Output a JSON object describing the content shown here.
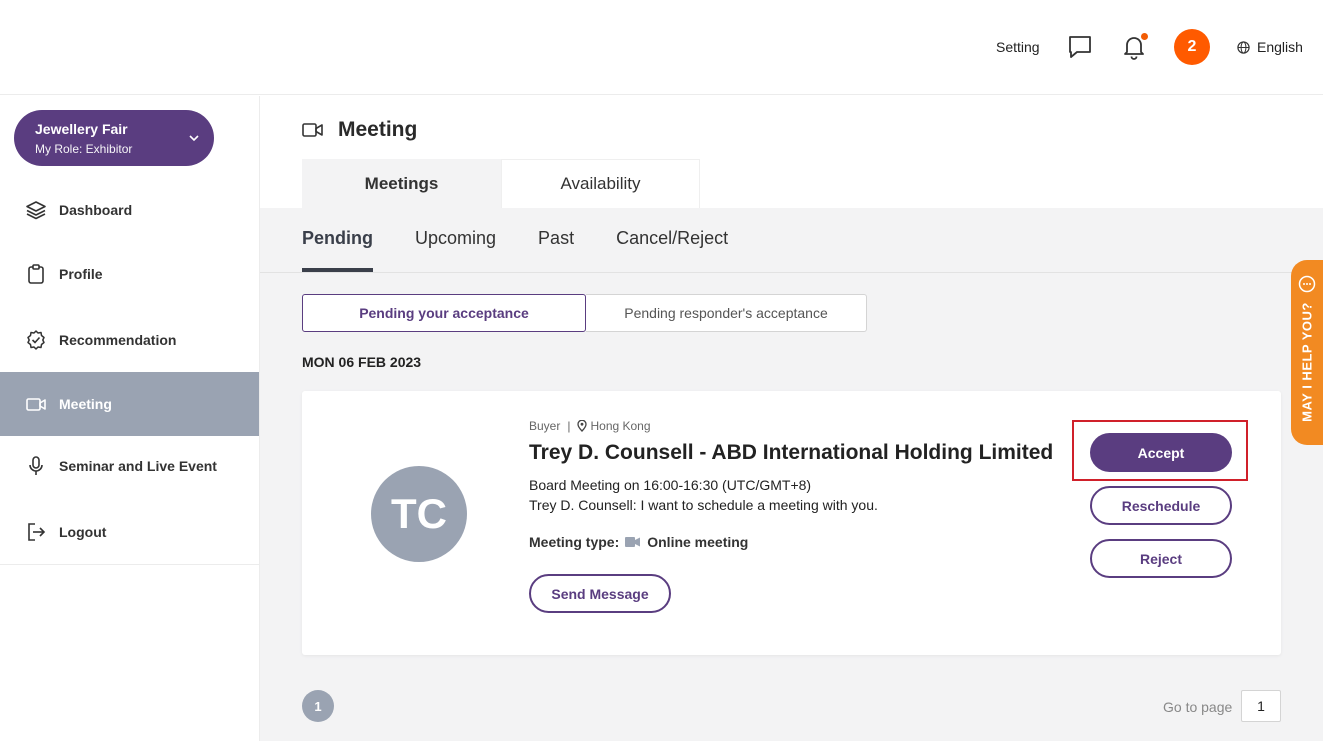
{
  "header": {
    "setting_label": "Setting",
    "notification_count": "2",
    "language_label": "English",
    "accent_color": "#ff5a00"
  },
  "sidebar": {
    "event": {
      "name": "Jewellery Fair",
      "role": "My Role: Exhibitor"
    },
    "items": [
      {
        "label": "Dashboard",
        "icon": "layers-icon"
      },
      {
        "label": "Profile",
        "icon": "clipboard-icon"
      },
      {
        "label": "Recommendation",
        "icon": "badge-check-icon"
      },
      {
        "label": "Meeting",
        "icon": "video-camera-icon",
        "active": true
      },
      {
        "label": "Seminar and Live Event",
        "icon": "microphone-icon"
      },
      {
        "label": "Logout",
        "icon": "logout-icon"
      }
    ],
    "brand_color": "#5a3d80"
  },
  "main": {
    "page_title": "Meeting",
    "top_tabs": [
      {
        "label": "Meetings",
        "active": true
      },
      {
        "label": "Availability",
        "active": false
      }
    ],
    "sub_tabs": [
      {
        "label": "Pending",
        "active": true
      },
      {
        "label": "Upcoming"
      },
      {
        "label": "Past"
      },
      {
        "label": "Cancel/Reject"
      }
    ],
    "segments": [
      {
        "label": "Pending your acceptance",
        "active": true
      },
      {
        "label": "Pending responder's acceptance",
        "active": false
      }
    ],
    "date_label": "MON 06 FEB 2023",
    "card": {
      "initials": "TC",
      "role": "Buyer",
      "location": "Hong Kong",
      "name": "Trey D. Counsell - ABD International Holding Limited",
      "schedule": "Board Meeting on 16:00-16:30 (UTC/GMT+8)",
      "message": "Trey D. Counsell: I want to schedule a meeting with you.",
      "meeting_type_label": "Meeting type:",
      "meeting_type_value": "Online meeting",
      "send_message_label": "Send Message",
      "accept_label": "Accept",
      "reschedule_label": "Reschedule",
      "reject_label": "Reject"
    },
    "pagination": {
      "current_page": "1",
      "goto_label": "Go to page",
      "goto_value": "1"
    }
  },
  "help_tab": {
    "label": "MAY I HELP YOU?"
  }
}
